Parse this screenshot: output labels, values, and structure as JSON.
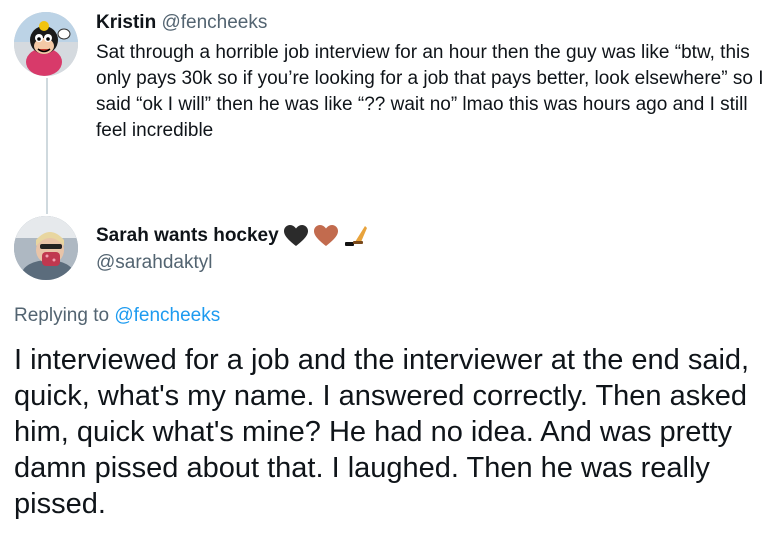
{
  "tweet1": {
    "display_name": "Kristin",
    "handle": "@fencheeks",
    "text": "Sat through a horrible job interview for an hour then the guy was like “btw, this only pays 30k so if you’re looking for a job that pays better, look elsewhere” so I said “ok I will” then he was like “?? wait no” lmao this was hours ago and I still feel incredible"
  },
  "tweet2": {
    "display_name": "Sarah wants hockey",
    "name_emojis": [
      "black-heart-icon",
      "brown-heart-icon",
      "hockey-stick-icon"
    ],
    "handle": "@sarahdaktyl",
    "replying_prefix": "Replying to",
    "replying_handle": "@fencheeks",
    "text": "I interviewed for a job and the interviewer at the end said, quick, what's my name. I answered correctly. Then asked him, quick what's mine? He had no idea. And was pretty damn pissed about that. I laughed. Then he was really pissed."
  },
  "colors": {
    "text": "#0f1419",
    "secondary": "#536471",
    "link": "#1d9bf0",
    "thread_line": "#cfd9de"
  }
}
